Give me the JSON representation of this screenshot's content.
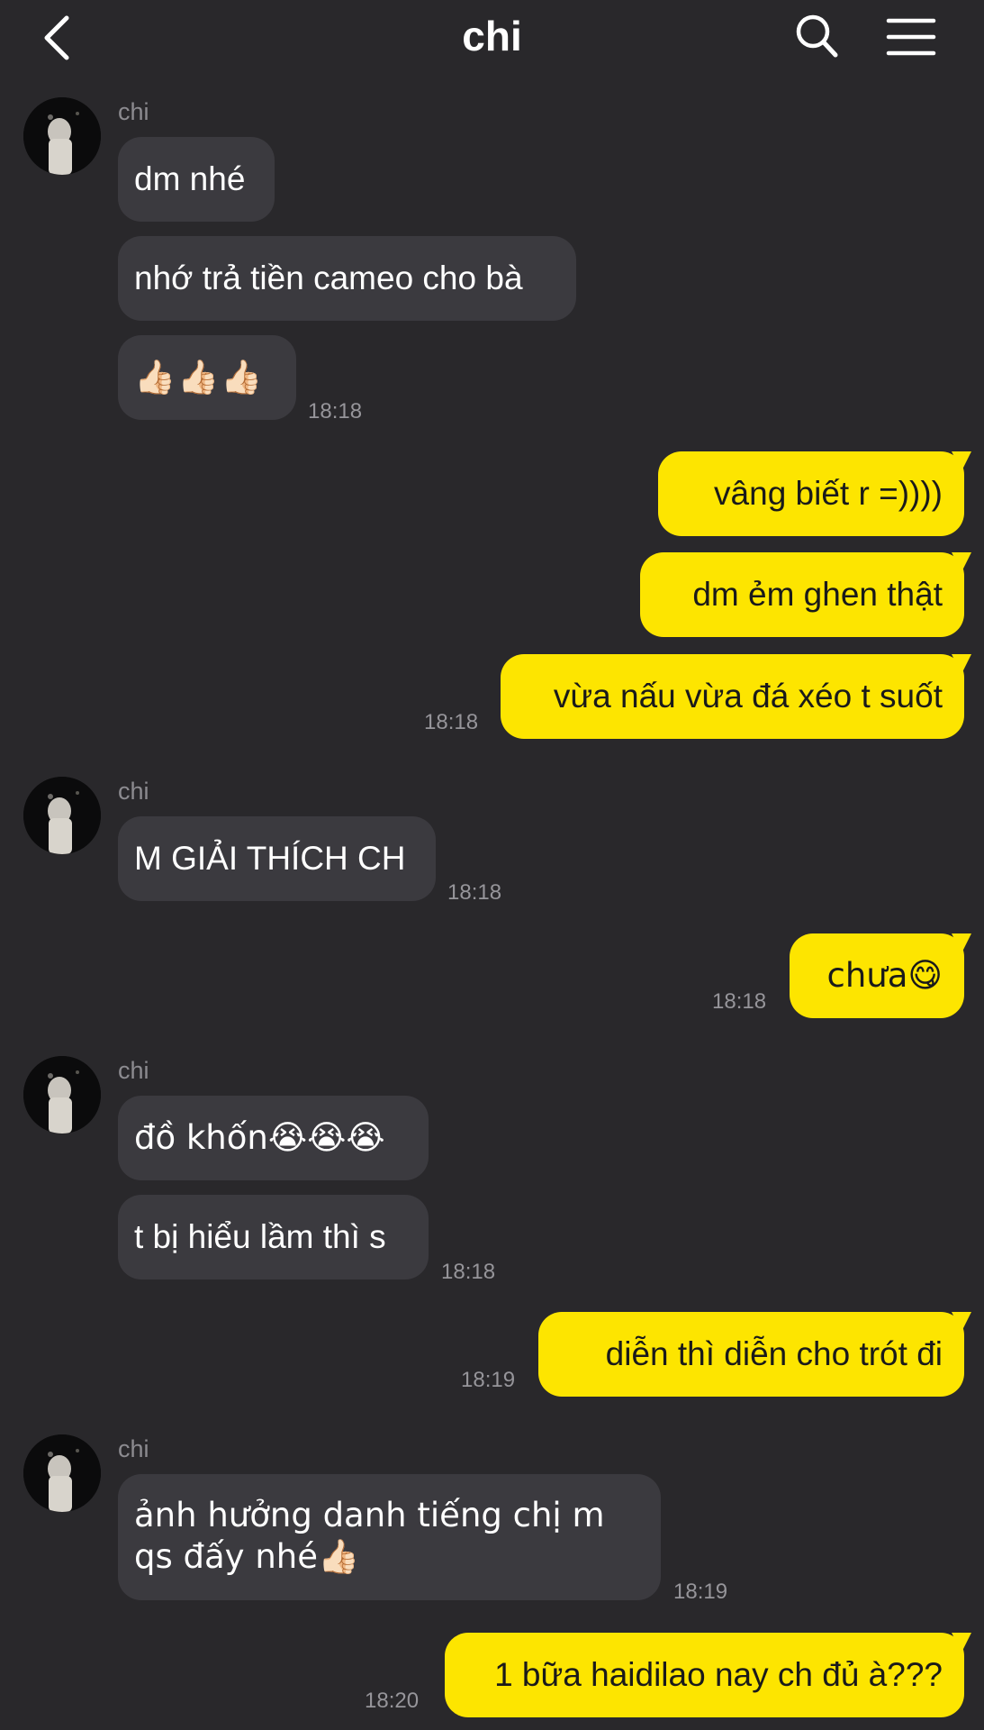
{
  "header": {
    "title": "chi",
    "back_icon": "chevron-left-icon",
    "search_icon": "search-icon",
    "menu_icon": "hamburger-menu-icon"
  },
  "colors": {
    "background": "#29282b",
    "incoming_bubble": "#3b3a3f",
    "outgoing_bubble": "#fde500",
    "timestamp": "#96959a"
  },
  "messages": [
    {
      "sender": "chi",
      "direction": "in",
      "bubbles": [
        "dm nhé",
        "nhớ trả tiền cameo cho bà",
        "👍🏻👍🏻👍🏻"
      ],
      "time": "18:18"
    },
    {
      "direction": "out",
      "bubbles": [
        "vâng biết r =))))",
        "dm ẻm ghen thật",
        "vừa nấu vừa đá xéo t suốt"
      ],
      "time": "18:18"
    },
    {
      "sender": "chi",
      "direction": "in",
      "bubbles": [
        "M GIẢI THÍCH CH"
      ],
      "time": "18:18"
    },
    {
      "direction": "out",
      "bubbles": [
        "chưa😋"
      ],
      "time": "18:18"
    },
    {
      "sender": "chi",
      "direction": "in",
      "bubbles": [
        "đồ khốn😭😭😭",
        "t bị hiểu lầm thì s"
      ],
      "time": "18:18"
    },
    {
      "direction": "out",
      "bubbles": [
        "diễn thì diễn cho trót đi"
      ],
      "time": "18:19"
    },
    {
      "sender": "chi",
      "direction": "in",
      "bubbles": [
        "ảnh hưởng danh tiếng chị m qs đấy nhé👍🏻"
      ],
      "time": "18:19"
    },
    {
      "direction": "out",
      "bubbles": [
        "1 bữa haidilao nay ch đủ à???"
      ],
      "time": "18:20"
    }
  ]
}
